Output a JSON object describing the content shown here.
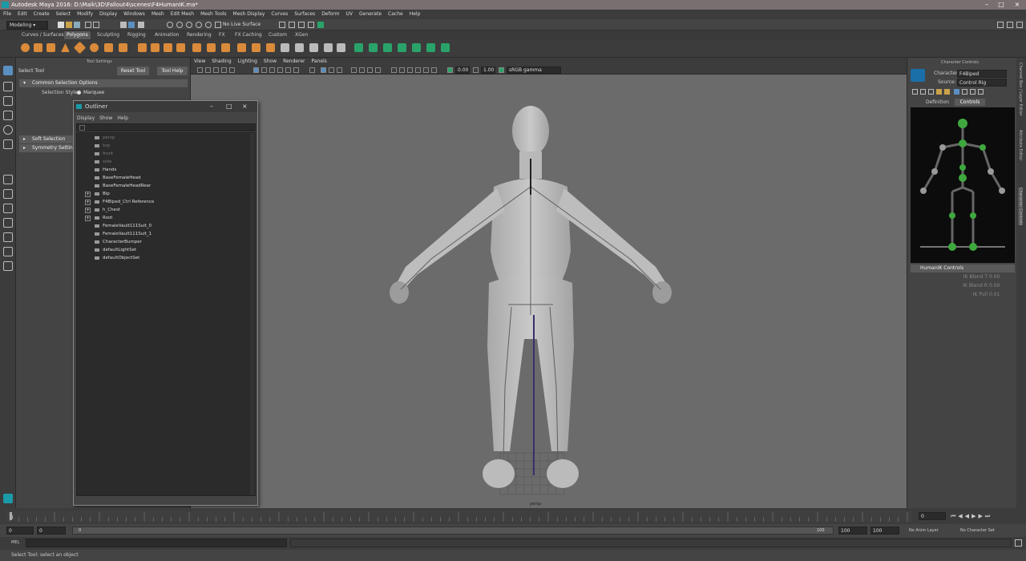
{
  "window": {
    "title": "Autodesk Maya 2016: D:\\Maik\\3D\\Fallout4\\scenes\\F4HumanIK.ma*"
  },
  "menubar": [
    "File",
    "Edit",
    "Create",
    "Select",
    "Modify",
    "Display",
    "Windows",
    "Mesh",
    "Edit Mesh",
    "Mesh Tools",
    "Mesh Display",
    "Curves",
    "Surfaces",
    "Deform",
    "UV",
    "Generate",
    "Cache",
    "Help"
  ],
  "statusline": {
    "mode": "Modeling",
    "live_surface": "No Live Surface"
  },
  "shelf_tabs": [
    "Curves / Surfaces",
    "Polygons",
    "Sculpting",
    "Rigging",
    "Animation",
    "Rendering",
    "FX",
    "FX Caching",
    "Custom",
    "XGen"
  ],
  "shelf_active": "Polygons",
  "tool_settings": {
    "panel_title": "Tool Settings",
    "tool_name": "Select Tool",
    "reset_button": "Reset Tool",
    "help_button": "Tool Help",
    "section_common": "Common Selection Options",
    "selection_style_label": "Selection Style:",
    "selection_style_value": "Marquee",
    "section_soft": "Soft Selection",
    "section_symmetry": "Symmetry Settings"
  },
  "outliner": {
    "title": "Outliner",
    "menu": [
      "Display",
      "Show",
      "Help"
    ],
    "items": [
      {
        "label": "persp",
        "dim": true,
        "expand": false
      },
      {
        "label": "top",
        "dim": true,
        "expand": false
      },
      {
        "label": "front",
        "dim": true,
        "expand": false
      },
      {
        "label": "side",
        "dim": true,
        "expand": false
      },
      {
        "label": "Hands",
        "dim": false,
        "expand": false
      },
      {
        "label": "BaseFemaleHead",
        "dim": false,
        "expand": false
      },
      {
        "label": "BaseFemaleHeadRear",
        "dim": false,
        "expand": false
      },
      {
        "label": "Bip",
        "dim": false,
        "expand": true
      },
      {
        "label": "F4Biped_Ctrl Reference",
        "dim": false,
        "expand": true
      },
      {
        "label": "h_Chest",
        "dim": false,
        "expand": true
      },
      {
        "label": "Root",
        "dim": false,
        "expand": true
      },
      {
        "label": "FemaleVault111Suit_0",
        "dim": false,
        "expand": false
      },
      {
        "label": "FemaleVault111Suit_1",
        "dim": false,
        "expand": false
      },
      {
        "label": "CharacterBumper",
        "dim": false,
        "expand": false
      },
      {
        "label": "defaultLightSet",
        "dim": false,
        "expand": false
      },
      {
        "label": "defaultObjectSet",
        "dim": false,
        "expand": false
      }
    ]
  },
  "viewport": {
    "menu": [
      "View",
      "Shading",
      "Lighting",
      "Show",
      "Renderer",
      "Panels"
    ],
    "exposure": "0.00",
    "gamma": "1.00",
    "color_space": "sRGB gamma",
    "camera_label": "persp"
  },
  "character_controls": {
    "title": "Character Controls",
    "character_label": "Character:",
    "character_value": "F4Biped",
    "source_label": "Source:",
    "source_value": "Control Rig",
    "tabs": [
      "Definition",
      "Controls"
    ],
    "active_tab": "Controls",
    "section": "HumanIK Controls",
    "rows": [
      {
        "label": "IK Blend T",
        "value": "0.00"
      },
      {
        "label": "IK Blend R",
        "value": "0.00"
      },
      {
        "label": "IK Pull",
        "value": "0.01"
      }
    ]
  },
  "right_strip": [
    "Channel Box / Layer Editor",
    "Attribute Editor",
    "Character Controls"
  ],
  "timeline": {
    "start_tick": "1",
    "current_frame": "0"
  },
  "range": {
    "start": "0",
    "anim_start": "0",
    "slider_start": "0",
    "slider_end": "100",
    "anim_end": "100",
    "end": "100",
    "anim_layer": "No Anim Layer",
    "char_set": "No Character Set"
  },
  "mel": {
    "label": "MEL"
  },
  "help_line": "Select Tool: select an object"
}
